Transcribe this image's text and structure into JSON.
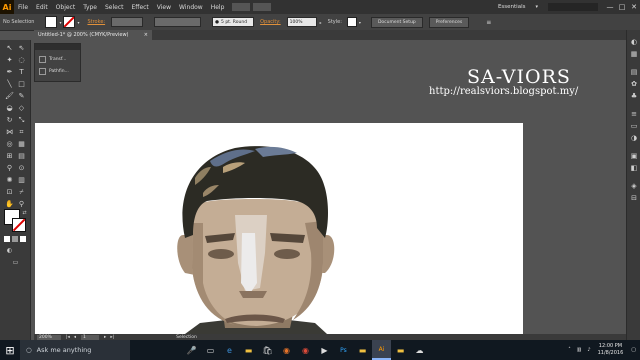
{
  "app": {
    "logo": "Ai"
  },
  "menu": [
    "File",
    "Edit",
    "Object",
    "Type",
    "Select",
    "Effect",
    "View",
    "Window",
    "Help"
  ],
  "workspace": "Essentials",
  "window_controls": [
    "—",
    "□",
    "✕"
  ],
  "control_bar": {
    "selection_label": "No Selection",
    "stroke_label": "Stroke:",
    "brush": "5 pt. Round",
    "opacity_label": "Opacity:",
    "opacity_value": "100%",
    "style_label": "Style:",
    "doc_setup_button": "Document Setup",
    "preferences_button": "Preferences"
  },
  "document_tab": {
    "title": "Untitled-1* @ 200% (CMYK/Preview)",
    "close": "×"
  },
  "float_panel": {
    "items": [
      "Transf...",
      "Pathfin..."
    ]
  },
  "watermark": {
    "title": "SA-VIORS",
    "url": "http://realsviors.blogspot.my/"
  },
  "status_bar": {
    "zoom": "200%",
    "page": "1",
    "tool": "Selection"
  },
  "taskbar": {
    "search_placeholder": "Ask me anything",
    "time": "12:00 PM",
    "date": "11/8/2016"
  },
  "colors": {
    "accent": "#ff9a00",
    "workspace_bg": "#535353",
    "panel_bg": "#3a3a3a",
    "taskbar_bg": "#101820"
  }
}
